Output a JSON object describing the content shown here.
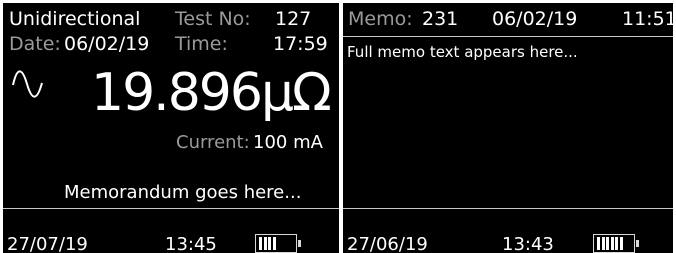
{
  "screen1": {
    "mode": "Unidirectional",
    "test_no_label": "Test No:",
    "test_no": "127",
    "date_label": "Date:",
    "date": "06/02/19",
    "time_label": "Time:",
    "time": "17:59",
    "waveform_icon": "sine-wave-icon",
    "reading": "19.896µΩ",
    "current_label": "Current:",
    "current": "100 mA",
    "memo": "Memorandum goes here...",
    "footer_date": "27/07/19",
    "footer_time": "13:45",
    "battery_level": 0.5
  },
  "screen2": {
    "memo_label": "Memo:",
    "memo_no": "231",
    "date": "06/02/19",
    "time": "11:51",
    "memo_text": "Full memo text appears here...",
    "footer_date": "27/06/19",
    "footer_time": "13:43",
    "battery_level": 0.75
  },
  "colors": {
    "background": "#000000",
    "text": "#ffffff",
    "label": "#9a9a9a"
  }
}
